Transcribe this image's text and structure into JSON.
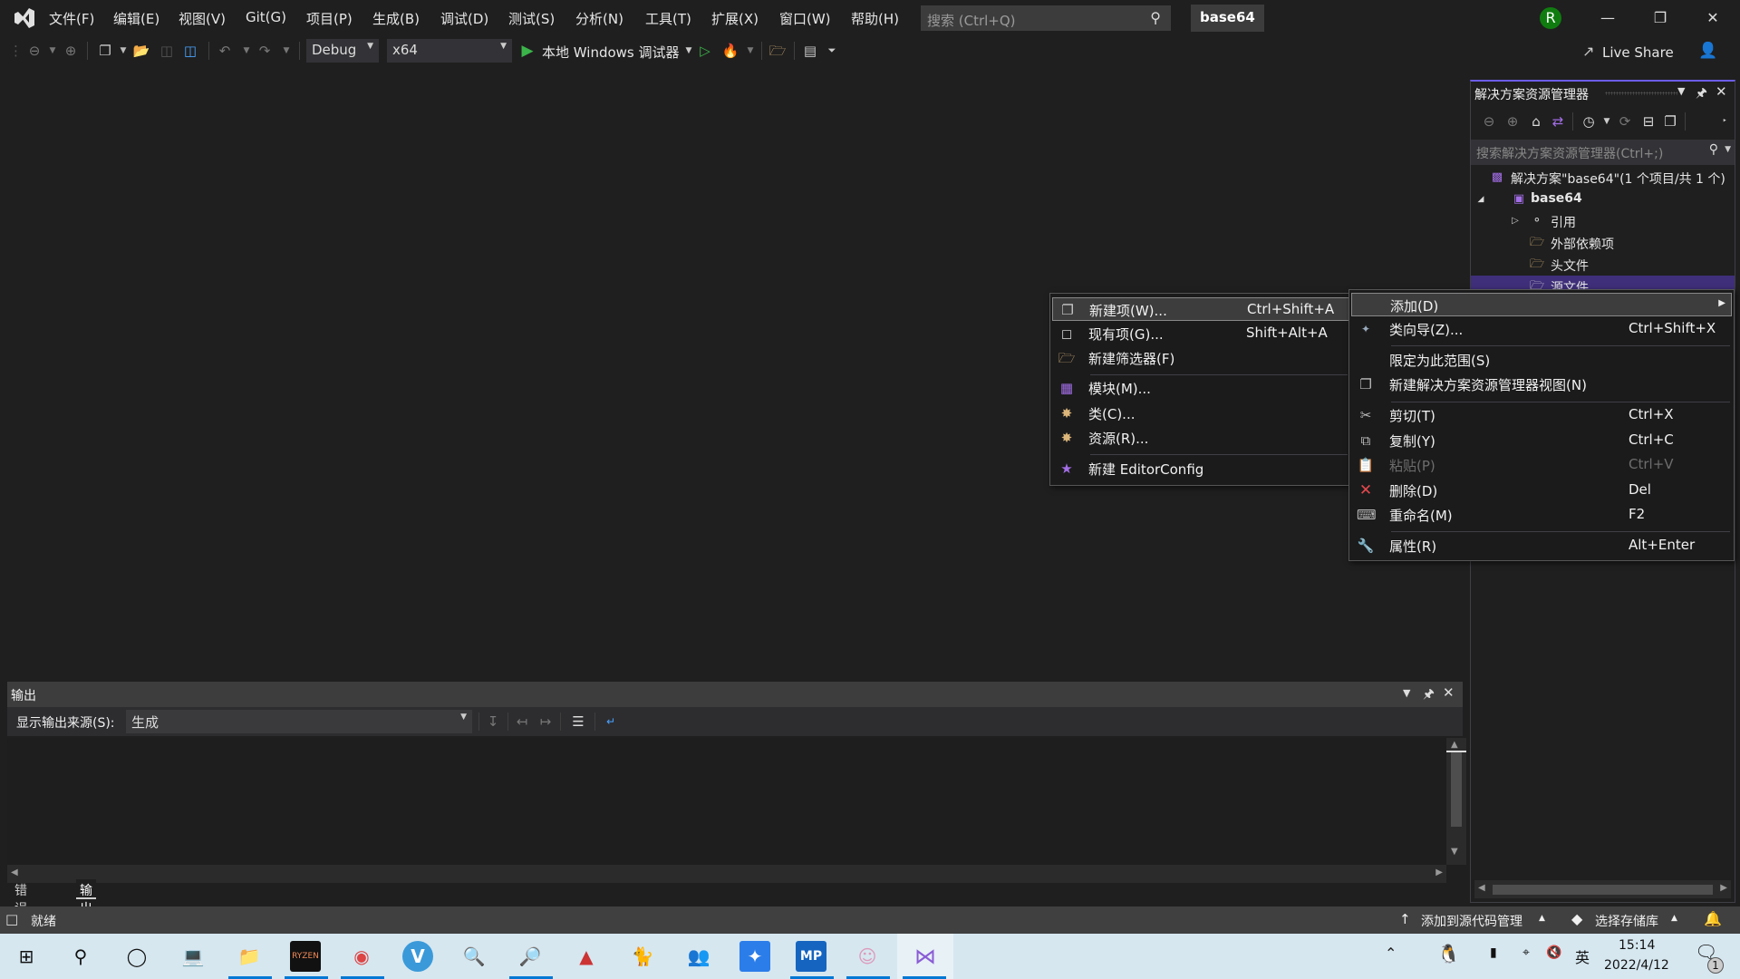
{
  "titlebar": {
    "menus": [
      "文件(F)",
      "编辑(E)",
      "视图(V)",
      "Git(G)",
      "项目(P)",
      "生成(B)",
      "调试(D)",
      "测试(S)",
      "分析(N)",
      "工具(T)",
      "扩展(X)",
      "窗口(W)",
      "帮助(H)"
    ],
    "search_placeholder": "搜索 (Ctrl+Q)",
    "solution_name": "base64",
    "avatar_initial": "R",
    "avatar_color": "#107c10"
  },
  "toolbar": {
    "configuration": "Debug",
    "platform": "x64",
    "run_label": "本地 Windows 调试器",
    "live_share": "Live Share"
  },
  "solution_explorer": {
    "title": "解决方案资源管理器",
    "search_placeholder": "搜索解决方案资源管理器(Ctrl+;)",
    "tree": [
      {
        "label": "解决方案\"base64\"(1 个项目/共 1 个)",
        "level": 0,
        "icon": "solution-icon"
      },
      {
        "label": "base64",
        "level": 1,
        "icon": "project-icon",
        "expanded": true,
        "bold": true
      },
      {
        "label": "引用",
        "level": 2,
        "icon": "reference-icon",
        "expandable": true
      },
      {
        "label": "外部依赖项",
        "level": 2,
        "icon": "external-deps-icon"
      },
      {
        "label": "头文件",
        "level": 2,
        "icon": "filter-folder-icon"
      },
      {
        "label": "源文件",
        "level": 2,
        "icon": "filter-folder-icon",
        "selected": true
      }
    ]
  },
  "context_menu": {
    "items": [
      {
        "label": "添加(D)",
        "shortcut": "",
        "icon": "",
        "submenu": true,
        "highlighted": true
      },
      {
        "label": "类向导(Z)...",
        "shortcut": "Ctrl+Shift+X",
        "icon": "class-wizard-icon"
      },
      {
        "label": "限定为此范围(S)",
        "shortcut": "",
        "icon": ""
      },
      {
        "label": "新建解决方案资源管理器视图(N)",
        "shortcut": "",
        "icon": "new-view-icon"
      },
      {
        "label": "剪切(T)",
        "shortcut": "Ctrl+X",
        "icon": "cut-icon"
      },
      {
        "label": "复制(Y)",
        "shortcut": "Ctrl+C",
        "icon": "copy-icon"
      },
      {
        "label": "粘贴(P)",
        "shortcut": "Ctrl+V",
        "icon": "paste-icon",
        "disabled": true
      },
      {
        "label": "删除(D)",
        "shortcut": "Del",
        "icon": "delete-icon"
      },
      {
        "label": "重命名(M)",
        "shortcut": "F2",
        "icon": "rename-icon"
      },
      {
        "label": "属性(R)",
        "shortcut": "Alt+Enter",
        "icon": "wrench-icon"
      }
    ]
  },
  "add_submenu": {
    "items": [
      {
        "label": "新建项(W)...",
        "shortcut": "Ctrl+Shift+A",
        "icon": "new-item-icon",
        "highlighted": true
      },
      {
        "label": "现有项(G)...",
        "shortcut": "Shift+Alt+A",
        "icon": "existing-item-icon"
      },
      {
        "label": "新建筛选器(F)",
        "shortcut": "",
        "icon": "new-filter-icon"
      },
      {
        "label": "模块(M)...",
        "shortcut": "",
        "icon": "module-icon"
      },
      {
        "label": "类(C)...",
        "shortcut": "",
        "icon": "class-icon"
      },
      {
        "label": "资源(R)...",
        "shortcut": "",
        "icon": "resource-icon"
      },
      {
        "label": "新建 EditorConfig",
        "shortcut": "",
        "icon": "editorconfig-icon"
      }
    ]
  },
  "output": {
    "title": "输出",
    "source_label": "显示输出来源(S):",
    "source_value": "生成",
    "tabs": [
      {
        "label": "错误列表",
        "active": false
      },
      {
        "label": "输出",
        "active": true
      }
    ]
  },
  "statusbar": {
    "status": "就绪",
    "source_control": "添加到源代码管理",
    "repository": "选择存储库"
  },
  "taskbar": {
    "apps": [
      "start",
      "search",
      "cortana",
      "this-pc",
      "file-explorer",
      "ryzen-master",
      "chrome",
      "vivaldi",
      "search-tool",
      "search-tool-2",
      "wps",
      "cat-app",
      "users-app",
      "feishu",
      "mp-app",
      "anime-app",
      "visual-studio"
    ],
    "time": "15:14",
    "date": "2022/4/12",
    "ime": "英",
    "notification_count": "1"
  }
}
